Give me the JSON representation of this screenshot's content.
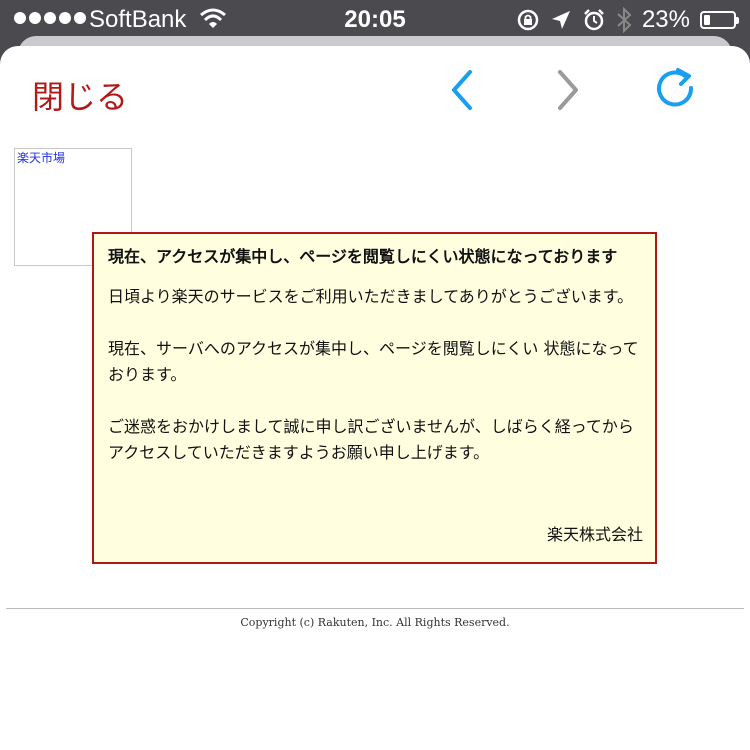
{
  "status_bar": {
    "carrier": "SoftBank",
    "time": "20:05",
    "battery": "23%",
    "battery_level": 0.23
  },
  "nav": {
    "close_label": "閉じる",
    "back_icon": "chevron-left-icon",
    "forward_icon": "chevron-right-icon",
    "reload_icon": "reload-icon",
    "close_color": "#b21a1a",
    "accent_color": "#1a9ef0",
    "disabled_color": "#9a9a9a"
  },
  "logo": {
    "alt_text": "楽天市場"
  },
  "notice": {
    "title": "現在、アクセスが集中し、ページを閲覧しにくい状態になっております",
    "paragraph1": "日頃より楽天のサービスをご利用いただきましてありがとうございます。",
    "paragraph2": "現在、サーバへのアクセスが集中し、ページを閲覧しにくい 状態になっております。",
    "paragraph3": "ご迷惑をおかけしまして誠に申し訳ございませんが、しばらく経ってからアクセスしていただきますようお願い申し上げます。",
    "signature": "楽天株式会社"
  },
  "footer": {
    "copyright": "Copyright (c) Rakuten, Inc. All Rights Reserved."
  }
}
